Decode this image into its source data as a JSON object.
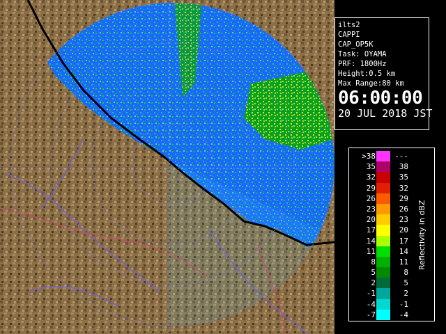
{
  "info": {
    "station": "ilts2",
    "product": "CAPPI",
    "product_code": "CAP_OP5K",
    "task": "Task: OYAMA",
    "prf": "PRF: 1800Hz",
    "height": "Height:0.5 km",
    "max_range": "Max Range:80 km",
    "time": "06:00:00",
    "date": "20 JUL 2018 JST"
  },
  "legend": {
    "title": "Reflectivity in dBZ",
    "rows": [
      {
        "lo": ">38",
        "hi": "---",
        "color": "#ff33ff"
      },
      {
        "lo": "35",
        "hi": "38",
        "color": "#b0006a"
      },
      {
        "lo": "32",
        "hi": "35",
        "color": "#c80000"
      },
      {
        "lo": "29",
        "hi": "32",
        "color": "#e02000"
      },
      {
        "lo": "26",
        "hi": "29",
        "color": "#ff5a00"
      },
      {
        "lo": "23",
        "hi": "26",
        "color": "#ff9a00"
      },
      {
        "lo": "20",
        "hi": "23",
        "color": "#ffcc00"
      },
      {
        "lo": "17",
        "hi": "20",
        "color": "#ffff00"
      },
      {
        "lo": "14",
        "hi": "17",
        "color": "#aaff00"
      },
      {
        "lo": "11",
        "hi": "14",
        "color": "#00e000"
      },
      {
        "lo": "8",
        "hi": "11",
        "color": "#00b000"
      },
      {
        "lo": "5",
        "hi": "8",
        "color": "#008a00"
      },
      {
        "lo": "2",
        "hi": "5",
        "color": "#006b3a"
      },
      {
        "lo": "-1",
        "hi": "2",
        "color": "#00a89c"
      },
      {
        "lo": "-4",
        "hi": "-1",
        "color": "#00d8d0"
      },
      {
        "lo": "-7",
        "hi": "-4",
        "color": "#00ffff"
      }
    ]
  },
  "map": {
    "sea_color": "#1a5cff",
    "land_color": "#8b6f47",
    "range_ring_color": "#6a7cff"
  }
}
